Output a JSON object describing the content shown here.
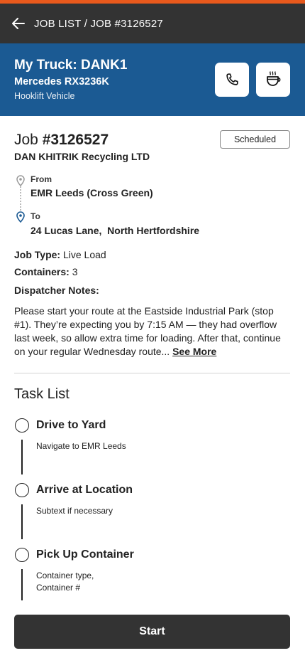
{
  "colors": {
    "accent": "#e8591c",
    "header_bg": "#333333",
    "truck_bar_bg": "#1b5a93",
    "button_bg": "#333333"
  },
  "header": {
    "breadcrumb": "JOB LIST / JOB #3126527",
    "back_icon": "arrow-left-icon"
  },
  "truck": {
    "title": "My Truck: DANK1",
    "model": "Mercedes RX3236K",
    "vehicle_type": "Hooklift Vehicle",
    "call_icon": "phone-icon",
    "break_icon": "coffee-cup-icon"
  },
  "job": {
    "label": "Job",
    "number": "#3126527",
    "company": "DAN KHITRIK Recycling LTD",
    "status": "Scheduled",
    "from_label": "From",
    "from_value": "EMR Leeds (Cross Green)",
    "to_label": "To",
    "to_value": "24 Lucas Lane,  North Hertfordshire",
    "job_type_label": "Job Type:",
    "job_type_value": "Live Load",
    "containers_label": "Containers:",
    "containers_value": "3",
    "notes_label": "Dispatcher Notes:",
    "notes_text": "Please start your route at the Eastside Industrial Park (stop #1). They’re expecting you by 7:15 AM — they had overflow last week, so allow extra time for loading. After that, continue on your regular Wednesday route...",
    "see_more": "See More"
  },
  "tasks": {
    "heading": "Task List",
    "items": [
      {
        "title": "Drive to Yard",
        "subtitle": "Navigate to EMR Leeds"
      },
      {
        "title": "Arrive at Location",
        "subtitle": "Subtext if necessary"
      },
      {
        "title": "Pick Up Container",
        "subtitle": "Container type,\nContainer #"
      }
    ]
  },
  "actions": {
    "start_label": "Start"
  }
}
